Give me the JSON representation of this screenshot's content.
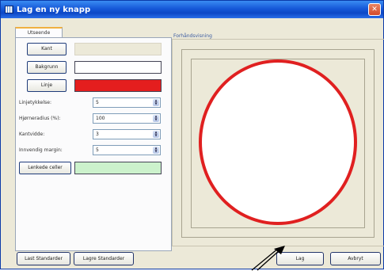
{
  "window": {
    "title": "Lag en ny knapp",
    "close_glyph": "✕"
  },
  "tabs": [
    {
      "label": "Utseende"
    }
  ],
  "buttons": {
    "kant": "Kant",
    "bakgrunn": "Bakgrunn",
    "linje": "Linje",
    "lenkede_celler": "Lenkede celler"
  },
  "fields": [
    {
      "label": "Linjetykkelse:",
      "value": "5"
    },
    {
      "label": "Hjørneradius (%):",
      "value": "100"
    },
    {
      "label": "Kantvidde:",
      "value": "3"
    },
    {
      "label": "Innvendig margin:",
      "value": "5"
    }
  ],
  "preview": {
    "label": "Forhåndsvisning"
  },
  "footer": {
    "last_standard": "Last Standarder",
    "lagre_standard": "Lagre Standarder",
    "lag": "Lag",
    "avbryt": "Avbryt"
  },
  "colors": {
    "kant_swatch": "#ece9d8",
    "bakgrunn_swatch": "#ffffff",
    "linje_swatch": "#e41e1e",
    "lenkede_swatch": "#ccf2cc",
    "preview_outline": "#e02020"
  },
  "icons": [
    "app-icon",
    "close-icon",
    "spin-arrows-icon",
    "pointer-arrow-icon"
  ]
}
